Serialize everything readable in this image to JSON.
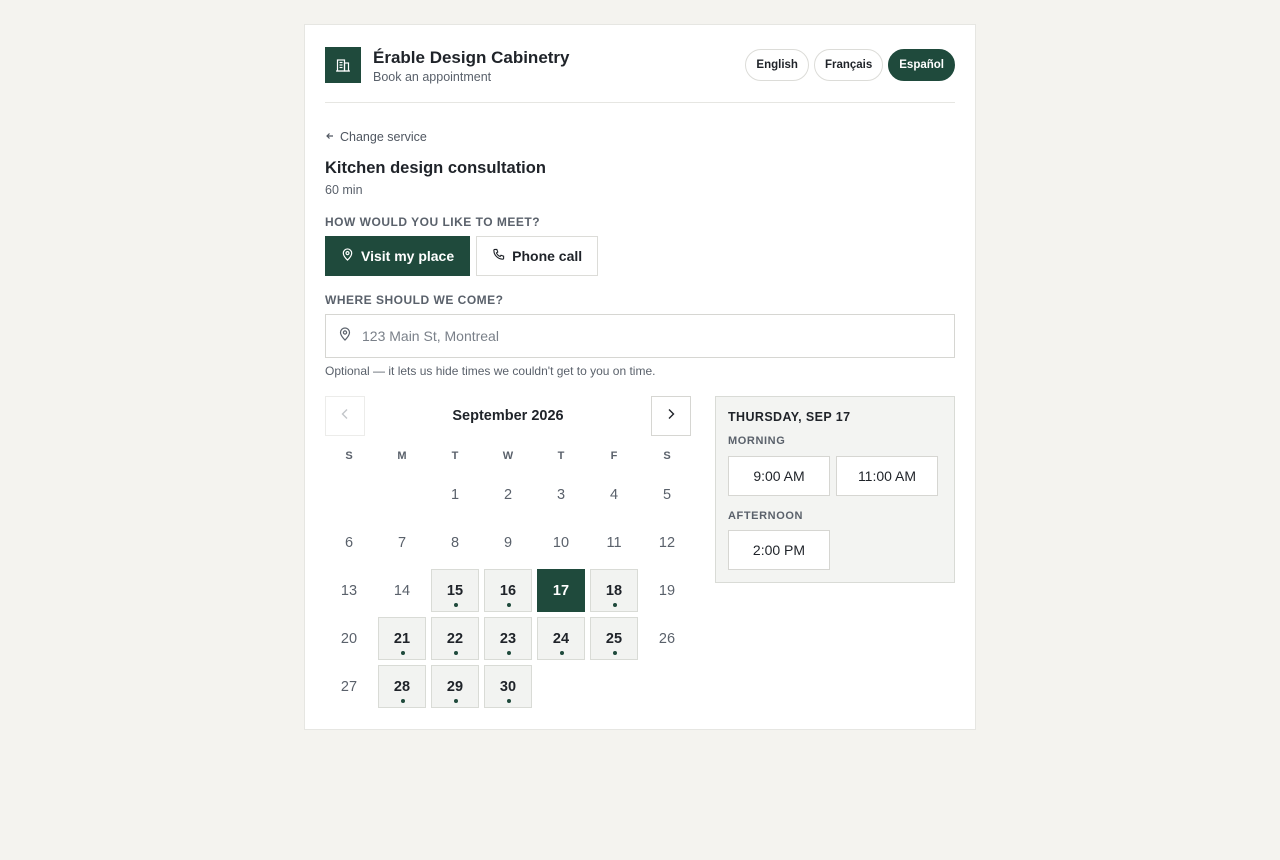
{
  "header": {
    "brand_name": "Érable Design Cabinetry",
    "brand_sub": "Book an appointment",
    "logo_icon": "building-icon",
    "brand_color": "#1f4a3c",
    "languages": [
      {
        "label": "English",
        "active": false
      },
      {
        "label": "Français",
        "active": false
      },
      {
        "label": "Español",
        "active": true
      }
    ]
  },
  "service": {
    "back_label": "Change service",
    "title": "Kitchen design consultation",
    "duration": "60 min"
  },
  "meet": {
    "label": "HOW WOULD YOU LIKE TO MEET?",
    "options": [
      {
        "label": "Visit my place",
        "icon": "map-pin-icon",
        "active": true
      },
      {
        "label": "Phone call",
        "icon": "phone-icon",
        "active": false
      }
    ]
  },
  "address": {
    "label": "WHERE SHOULD WE COME?",
    "value": "",
    "placeholder": "123 Main St, Montreal",
    "hint": "Optional — it lets us hide times we couldn't get to you on time."
  },
  "calendar": {
    "month": "September 2026",
    "weekdays": [
      "S",
      "M",
      "T",
      "W",
      "T",
      "F",
      "S"
    ],
    "days": [
      {
        "d": "",
        "s": "empty"
      },
      {
        "d": "",
        "s": "empty"
      },
      {
        "d": "1",
        "s": "off"
      },
      {
        "d": "2",
        "s": "off"
      },
      {
        "d": "3",
        "s": "off"
      },
      {
        "d": "4",
        "s": "off"
      },
      {
        "d": "5",
        "s": "off"
      },
      {
        "d": "6",
        "s": "off"
      },
      {
        "d": "7",
        "s": "off"
      },
      {
        "d": "8",
        "s": "off"
      },
      {
        "d": "9",
        "s": "off"
      },
      {
        "d": "10",
        "s": "off"
      },
      {
        "d": "11",
        "s": "off"
      },
      {
        "d": "12",
        "s": "off"
      },
      {
        "d": "13",
        "s": "off"
      },
      {
        "d": "14",
        "s": "off"
      },
      {
        "d": "15",
        "s": "avail"
      },
      {
        "d": "16",
        "s": "avail"
      },
      {
        "d": "17",
        "s": "selected"
      },
      {
        "d": "18",
        "s": "avail"
      },
      {
        "d": "19",
        "s": "off"
      },
      {
        "d": "20",
        "s": "off"
      },
      {
        "d": "21",
        "s": "avail"
      },
      {
        "d": "22",
        "s": "avail"
      },
      {
        "d": "23",
        "s": "avail"
      },
      {
        "d": "24",
        "s": "avail"
      },
      {
        "d": "25",
        "s": "avail"
      },
      {
        "d": "26",
        "s": "off"
      },
      {
        "d": "27",
        "s": "off"
      },
      {
        "d": "28",
        "s": "avail"
      },
      {
        "d": "29",
        "s": "avail"
      },
      {
        "d": "30",
        "s": "avail"
      }
    ]
  },
  "slots": {
    "date": "THURSDAY, SEP 17",
    "morning_label": "MORNING",
    "morning": [
      "9:00 AM",
      "11:00 AM"
    ],
    "afternoon_label": "AFTERNOON",
    "afternoon": [
      "2:00 PM"
    ]
  }
}
